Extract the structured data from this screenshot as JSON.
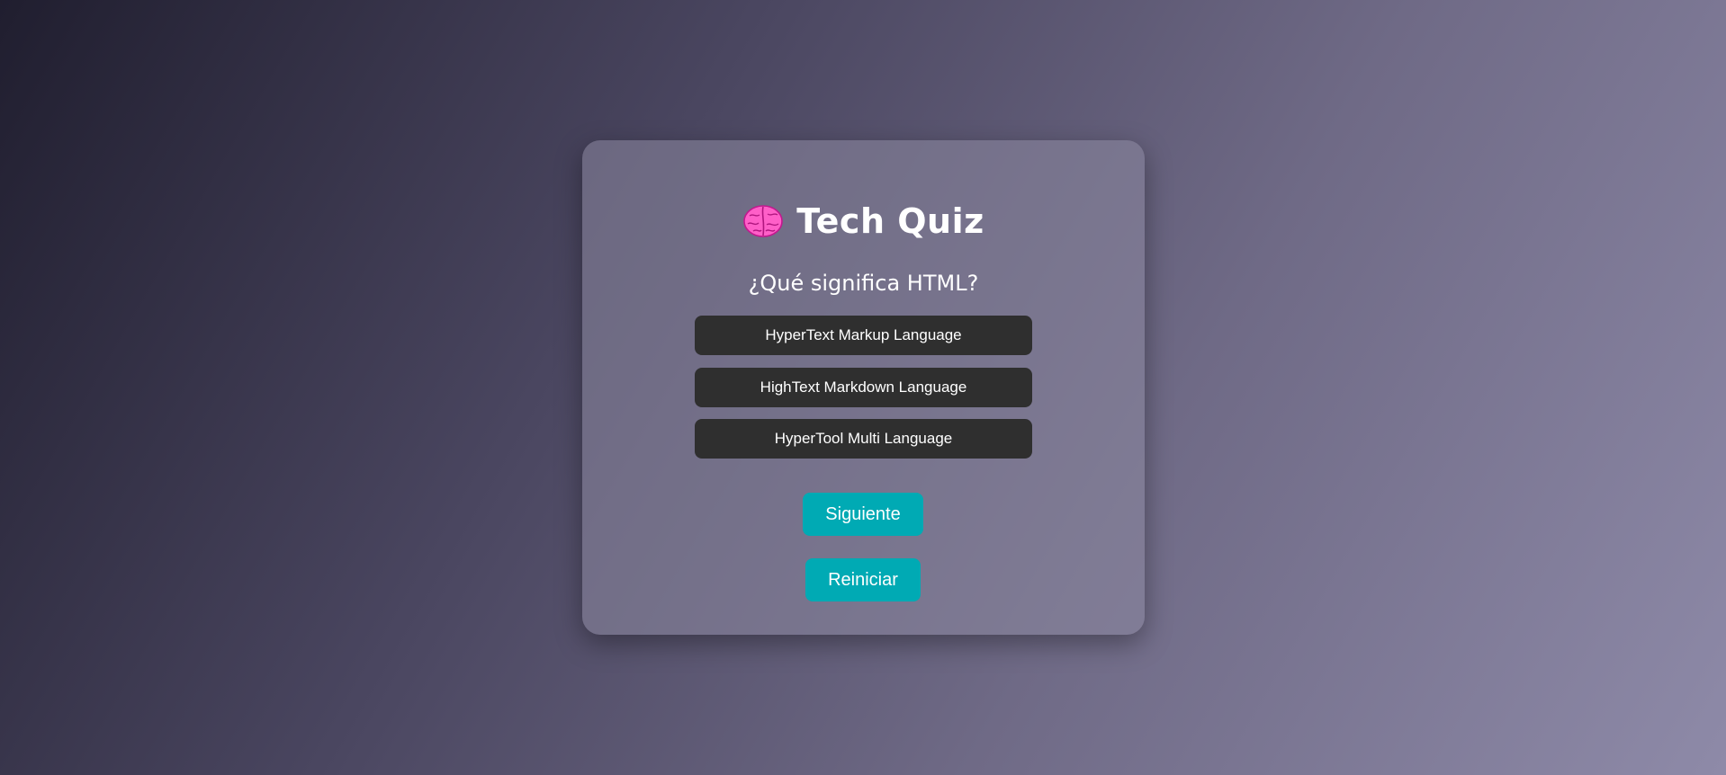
{
  "quiz": {
    "icon": "brain-icon",
    "title": "Tech Quiz",
    "question": "¿Qué significa HTML?",
    "options": [
      {
        "label": "HyperText Markup Language"
      },
      {
        "label": "HighText Markdown Language"
      },
      {
        "label": "HyperTool Multi Language"
      }
    ],
    "next_label": "Siguiente",
    "reset_label": "Reiniciar"
  },
  "colors": {
    "accent": "#00aab4",
    "option_bg": "#2f2f2f",
    "brain": "#ff5fc8"
  }
}
